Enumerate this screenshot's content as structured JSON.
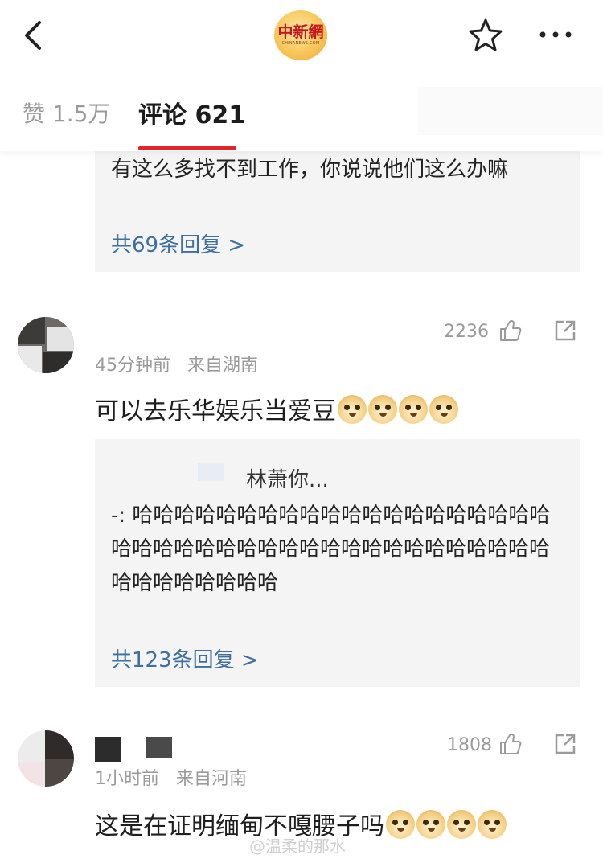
{
  "header": {
    "logo_text": "中新網",
    "logo_subtext": "CHINANEWS.COM"
  },
  "tabs": {
    "likes_label": "赞 1.5万",
    "comments_label": "评论 621"
  },
  "comments": [
    {
      "reply_preview": {
        "text": "有这么多找不到工作，你说说他们这么办嘛",
        "more": "共69条回复 >"
      }
    },
    {
      "likes": "2236",
      "time": "45分钟前",
      "location": "来自湖南",
      "text": "可以去乐华娱乐当爱豆",
      "emoji_count": 4,
      "reply_preview": {
        "author": "林萧你...",
        "prefix": "-:",
        "text": "哈哈哈哈哈哈哈哈哈哈哈哈哈哈哈哈哈哈哈哈哈哈哈哈哈哈哈哈哈哈哈哈哈哈哈哈哈哈哈哈哈哈哈哈哈哈哈哈哈",
        "more": "共123条回复 >"
      }
    },
    {
      "likes": "1808",
      "time": "1小时前",
      "location": "来自河南",
      "text": "这是在证明缅甸不嘎腰子吗",
      "emoji_count": 4
    }
  ],
  "watermark": "@温柔的那水",
  "icons": [
    "back-icon",
    "star-icon",
    "more-icon",
    "thumb-up-icon",
    "share-icon",
    "doge-emoji"
  ],
  "colors": {
    "accent_red": "#e0262b",
    "link_blue": "#3e6f9e",
    "meta_gray": "#9b9b9b"
  }
}
